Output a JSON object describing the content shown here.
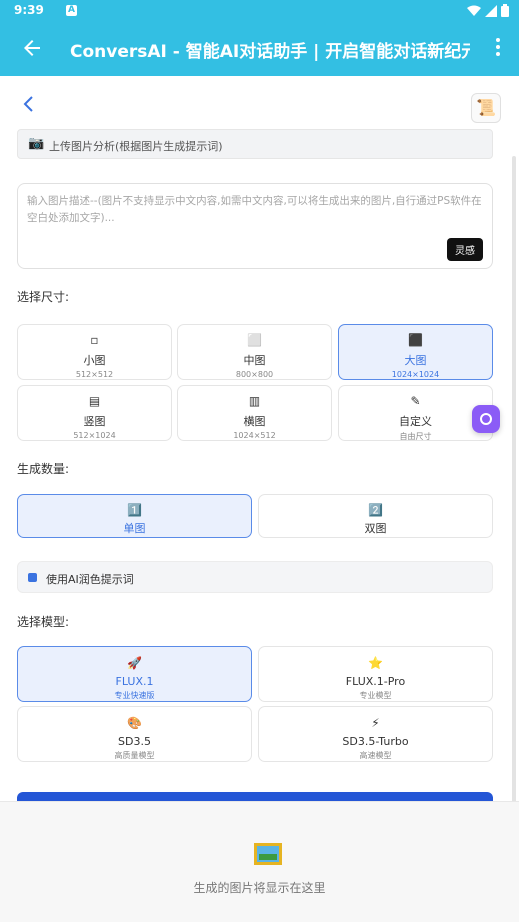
{
  "status_bar": {
    "time": "9:39",
    "notif_icon": "A"
  },
  "app_bar": {
    "title": "ConversAI - 智能AI对话助手 | 开启智能对话新纪元"
  },
  "upload": {
    "icon": "📷",
    "label": "上传图片分析(根据图片生成提示词)"
  },
  "prompt": {
    "placeholder": "输入图片描述--(图片不支持显示中文内容,如需中文内容,可以将生成出来的图片,自行通过PS软件在空白处添加文字)...",
    "inspire_label": "灵感"
  },
  "size": {
    "label": "选择尺寸:",
    "options": [
      {
        "icon": "▫",
        "name": "小图",
        "sub": "512×512",
        "selected": false
      },
      {
        "icon": "⬜",
        "name": "中图",
        "sub": "800×800",
        "selected": false
      },
      {
        "icon": "⬛",
        "name": "大图",
        "sub": "1024×1024",
        "selected": true
      },
      {
        "icon": "▤",
        "name": "竖图",
        "sub": "512×1024",
        "selected": false
      },
      {
        "icon": "▥",
        "name": "横图",
        "sub": "1024×512",
        "selected": false
      },
      {
        "icon": "✎",
        "name": "自定义",
        "sub": "自由尺寸",
        "selected": false
      }
    ]
  },
  "count": {
    "label": "生成数量:",
    "options": [
      {
        "icon": "1️⃣",
        "name": "单图",
        "selected": true
      },
      {
        "icon": "2️⃣",
        "name": "双图",
        "selected": false
      }
    ]
  },
  "ai_polish": {
    "label": "使用AI润色提示词",
    "checked": true
  },
  "model": {
    "label": "选择模型:",
    "options": [
      {
        "icon": "🚀",
        "name": "FLUX.1",
        "sub": "专业快速版",
        "selected": true
      },
      {
        "icon": "⭐",
        "name": "FLUX.1-Pro",
        "sub": "专业模型",
        "selected": false
      },
      {
        "icon": "🎨",
        "name": "SD3.5",
        "sub": "高质量模型",
        "selected": false
      },
      {
        "icon": "⚡",
        "name": "SD3.5-Turbo",
        "sub": "高速模型",
        "selected": false
      }
    ]
  },
  "preview": {
    "message": "生成的图片将显示在这里"
  },
  "colors": {
    "app_bar": "#33bfe3",
    "accent": "#3b73e0",
    "generate_button": "#2456d6",
    "float_button": "#8b5cf6"
  }
}
